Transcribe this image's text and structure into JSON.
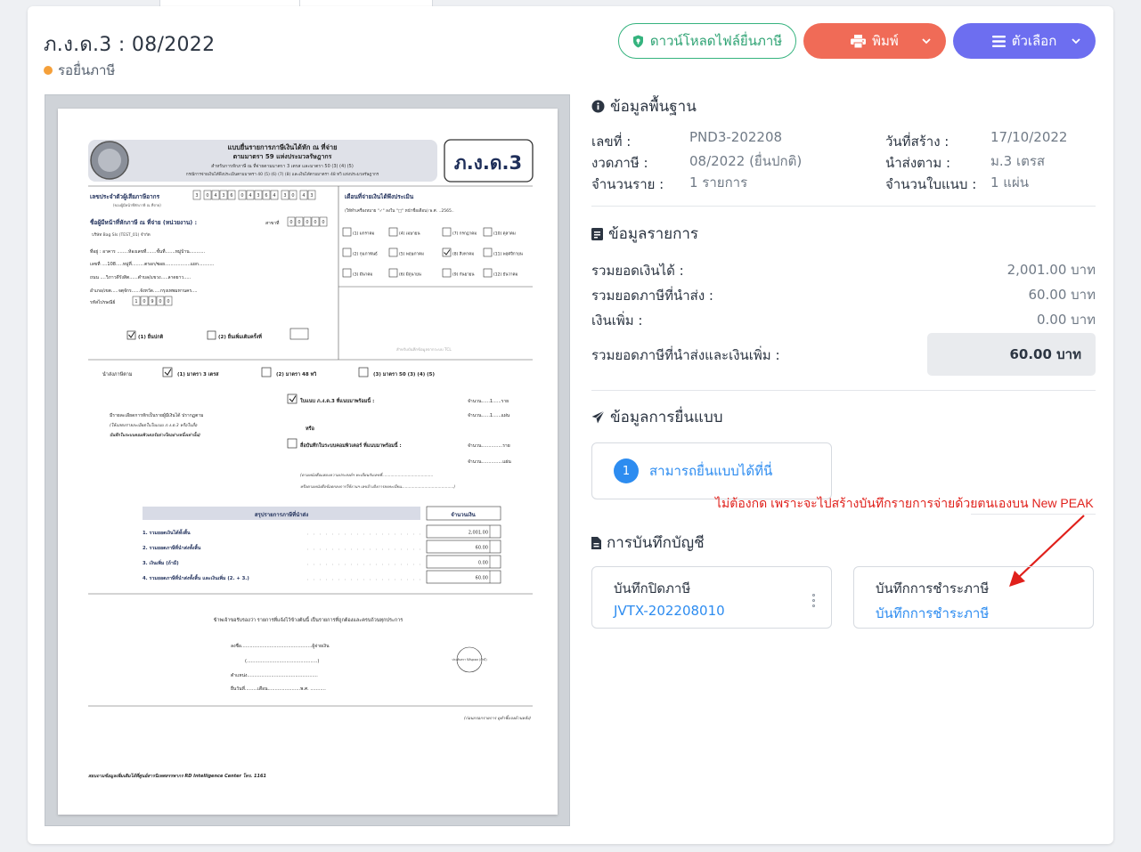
{
  "header": {
    "title": "ภ.ง.ด.3 : 08/2022",
    "status": "รอยื่นภาษี",
    "status_color": "#f5a03a"
  },
  "buttons": {
    "download": "ดาวน์โหลดไฟล์ยื่นภาษี",
    "print": "พิมพ์",
    "options": "ตัวเลือก"
  },
  "basic_info": {
    "title": "ข้อมูลพื้นฐาน",
    "number_label": "เลขที่ :",
    "number_value": "PND3-202208",
    "period_label": "งวดภาษี :",
    "period_value": "08/2022 (ยื่นปกติ)",
    "items_label": "จำนวนราย :",
    "items_value": "1 รายการ",
    "created_label": "วันที่สร้าง :",
    "created_value": "17/10/2022",
    "submit_by_label": "นำส่งตาม :",
    "submit_by_value": "ม.3 เตรส",
    "sheets_label": "จำนวนใบแนบ :",
    "sheets_value": "1 แผ่น"
  },
  "details": {
    "title": "ข้อมูลรายการ",
    "income_label": "รวมยอดเงินได้ :",
    "income_value": "2,001.00 บาท",
    "tax_label": "รวมยอดภาษีที่นำส่ง :",
    "tax_value": "60.00 บาท",
    "surcharge_label": "เงินเพิ่ม :",
    "surcharge_value": "0.00 บาท",
    "total_label": "รวมยอดภาษีที่นำส่งและเงินเพิ่ม :",
    "total_value": "60.00 บาท"
  },
  "filing": {
    "title": "ข้อมูลการยื่นแบบ",
    "step_number": "1",
    "step_text": "สามารถยื่นแบบได้ที่นี่"
  },
  "annotation": {
    "note": "ไม่ต้องกด เพราะจะไปสร้างบันทึกรายการจ่ายด้วยตนเองบน New PEAK",
    "color": "#e0201b"
  },
  "accounting": {
    "title": "การบันทึกบัญชี",
    "close_title": "บันทึกปิดภาษี",
    "close_link": "JVTX-202208010",
    "payment_title": "บันทึกการชำระภาษี",
    "payment_link": "บันทึกการชำระภาษี"
  },
  "form_preview": {
    "logo_text": "ภ.ง.ด.3",
    "heading1": "แบบยื่นรายการภาษีเงินได้หัก ณ ที่จ่าย",
    "heading2": "ตามมาตรา 59 แห่งประมวลรัษฎากร",
    "heading3": "สำหรับการหักภาษี ณ ที่จ่ายตามมาตรา 3 เตรส และมาตรา 50 (3) (4) (5)",
    "heading4": "กรณีการจ่ายเงินได้พึงประเมินตามมาตรา 40 (5) (6) (7) (8) และเงินได้ตามมาตรา 48 ทวิ แห่งประมวลรัษฎากร",
    "taxid_label": "เลขประจำตัวผู้เสียภาษีอากร",
    "taxid_sub": "(ของผู้มีหน้าที่หักภาษี ณ ที่จ่าย)",
    "taxid_digits": [
      "3",
      "0",
      "4",
      "3",
      "6",
      "0",
      "4",
      "3",
      "6",
      "4",
      "3",
      "0",
      "4",
      "3"
    ],
    "branch_digits": [
      "0",
      "0",
      "0",
      "0",
      "0"
    ],
    "payer_label": "ชื่อผู้มีหน้าที่หักภาษี ณ ที่จ่าย (หน่วยงาน) :",
    "branch_label": "สาขาที่",
    "payer_name": "บริษัท Bag SIs (TEST_01) จำกัด",
    "address_line1": "ที่อยู่ : อาคาร ........ห้องเลขที่.......ชั้นที่.......หมู่บ้าน...........",
    "address_line2": "เลขที่ ....108.....หมู่ที่.........ตรอก/ซอย..................แยก...........",
    "address_line3": "ถนน ....วิภาวดีรังสิต......ตำบล/แขวง.....ลาดยาว.....",
    "address_line4": "อำเภอ/เขต.....จตุจักร......จังหวัด.....กรุงเทพมหานคร....",
    "postcode_label": "รหัสไปรษณีย์",
    "postcode_digits": [
      "1",
      "0",
      "9",
      "0",
      "0"
    ],
    "month_title": "เดือนที่จ่ายเงินได้พึงประเมิน",
    "month_hint": "(ให้ทำเครื่องหมาย \"✓\" ลงใน \"□\" หน้าชื่อเดือน) พ.ศ. ..2565..",
    "months": [
      "(1) มกราคม",
      "(4) เมษายน",
      "(7) กรกฎาคม",
      "(10) ตุลาคม",
      "(2) กุมภาพันธ์",
      "(5) พฤษภาคม",
      "(8) สิงหาคม",
      "(11) พฤศจิกายน",
      "(3) มีนาคม",
      "(6) มิถุนายน",
      "(9) กันยายน",
      "(12) ธันวาคม"
    ],
    "filing_normal": "(1) ยื่นปกติ",
    "filing_extra": "(2) ยื่นเพิ่มเติมครั้งที่",
    "stamp_note": "สำหรับบันทึกข้อมูลจากระบบ TCL",
    "submit_label": "นำส่งภาษีตาม",
    "submit_opt1": "(1) มาตรา 3 เตรส",
    "submit_opt2": "(2) มาตรา 48 ทวิ",
    "submit_opt3": "(3) มาตรา 50 (3) (4) (5)",
    "attach1": "ใบแนบ ภ.ง.ด.3 ที่แนบมาพร้อมนี้ :",
    "attach_count1": "จำนวน......1......ราย",
    "attach_count2": "จำนวน......1......แผ่น",
    "attach_or": "หรือ",
    "attach2": "สื่อบันทึกในระบบคอมพิวเตอร์ ที่แนบมาพร้อมนี้ :",
    "attach_count3": "จำนวน...............ราย",
    "attach_count4": "จำนวน...............แผ่น",
    "detail_note1": "มีรายละเอียดการหักเป็นรายผู้มีเงินได้ ปรากฏตาม",
    "detail_note2": "(ให้แสดงรายละเอียดในใบแนบ ภ.ง.ด.3 หรือในสื่อ",
    "detail_note3": "บันทึกในระบบคอมพิวเตอร์อย่างใดอย่างหนึ่งเท่านั้น)",
    "media_note1": "(ตามหนังสือแสดงความประสงค์ฯ ทะเบียนรับเลขที่..........................................",
    "media_note2": "หรือตามหนังสือข้อตกลงการใช้งานฯ เลขอ้างอิงการลงทะเบียน...........................................)",
    "summary_title": "สรุปรายการภาษีที่นำส่ง",
    "summary_amount_title": "จำนวนเงิน",
    "summary_rows": [
      "1. รวมยอดเงินได้ทั้งสิ้น",
      "2. รวมยอดภาษีที่นำส่งทั้งสิ้น",
      "3. เงินเพิ่ม (ถ้ามี)",
      "4. รวมยอดภาษีที่นำส่งทั้งสิ้น และเงินเพิ่ม (2. + 3.)"
    ],
    "summary_values": [
      "2,001.00",
      "60.00",
      "0.00",
      "60.00"
    ],
    "certify": "ข้าพเจ้าขอรับรองว่า รายการที่แจ้งไว้ข้างต้นนี้ เป็นรายการที่ถูกต้องและครบถ้วนทุกประการ",
    "sign_line": "ลงชื่อ..................................................ผู้จ่ายเงิน",
    "sign_paren": "(..................................................)",
    "position_line": "ตำแหน่ง..................................................",
    "date_line": "ยื่นวันที่.........เดือน.......................พ.ศ. ...........",
    "seal_text": "ประทับตรา นิติบุคคล (ถ้ามี)",
    "see_back": "(ก่อนกรอกรายการ ดูคำชี้แจงด้านหลัง)",
    "footer": "สอบถามข้อมูลเพิ่มเติมได้ที่ศูนย์สารนิเทศสรรพากร RD Intelligence Center โทร. 1161"
  }
}
